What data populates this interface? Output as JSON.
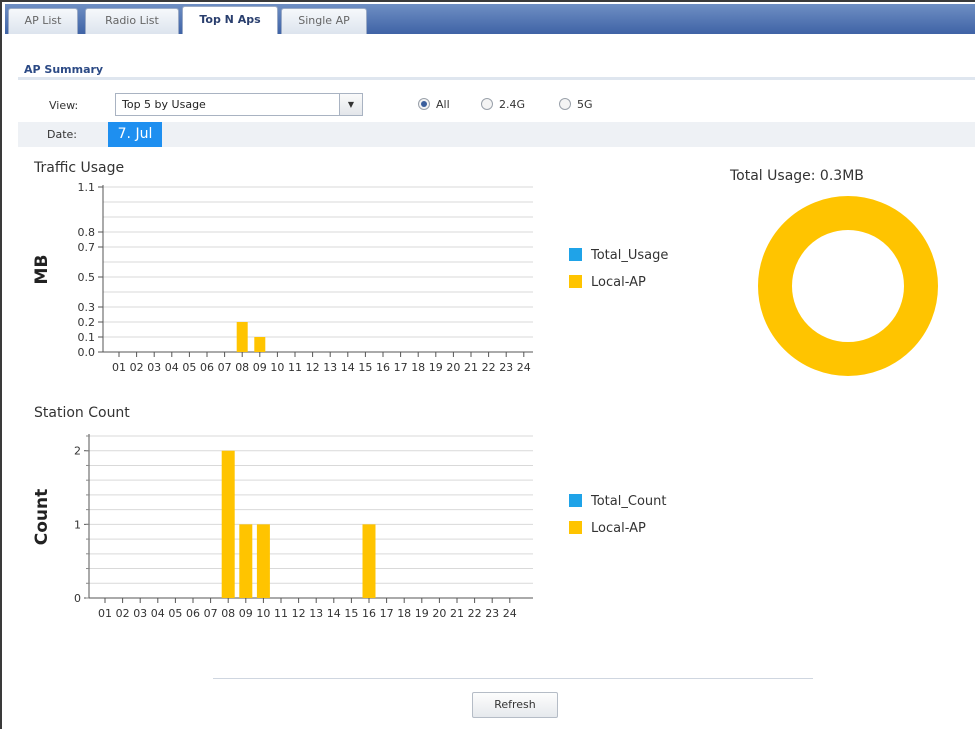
{
  "tabs": [
    {
      "label": "AP List",
      "active": false
    },
    {
      "label": "Radio List",
      "active": false
    },
    {
      "label": "Top N Aps",
      "active": true
    },
    {
      "label": "Single AP",
      "active": false
    }
  ],
  "section": {
    "title": "AP Summary"
  },
  "filters": {
    "view_label": "View:",
    "view_value": "Top 5 by Usage",
    "band_options": [
      {
        "label": "All",
        "selected": true
      },
      {
        "label": "2.4G",
        "selected": false
      },
      {
        "label": "5G",
        "selected": false
      }
    ],
    "date_label": "Date:",
    "date_value": "7. Jul"
  },
  "colors": {
    "total": "#1fa3e8",
    "local_ap": "#ffc400",
    "accent": "#1e8ff0"
  },
  "traffic": {
    "title": "Traffic Usage"
  },
  "station": {
    "title": "Station Count"
  },
  "donut": {
    "title": "Total Usage: 0.3MB"
  },
  "buttons": {
    "refresh": "Refresh"
  },
  "chart_data": [
    {
      "type": "bar",
      "title": "Traffic Usage",
      "ylabel": "MB",
      "categories": [
        "01",
        "02",
        "03",
        "04",
        "05",
        "06",
        "07",
        "08",
        "09",
        "10",
        "11",
        "12",
        "13",
        "14",
        "15",
        "16",
        "17",
        "18",
        "19",
        "20",
        "21",
        "22",
        "23",
        "24"
      ],
      "y_ticks": [
        0.0,
        0.1,
        0.2,
        0.3,
        0.5,
        0.7,
        0.8,
        1.1
      ],
      "ylim": [
        0,
        1.1
      ],
      "series": [
        {
          "name": "Total_Usage",
          "values": [
            0,
            0,
            0,
            0,
            0,
            0,
            0,
            0,
            0,
            0,
            0,
            0,
            0,
            0,
            0,
            0,
            0,
            0,
            0,
            0,
            0,
            0,
            0,
            0
          ]
        },
        {
          "name": "Local-AP",
          "values": [
            0,
            0,
            0,
            0,
            0,
            0,
            0,
            0.2,
            0.1,
            0,
            0,
            0,
            0,
            0,
            0,
            0,
            0,
            0,
            0,
            0,
            0,
            0,
            0,
            0
          ]
        }
      ],
      "legend": "right"
    },
    {
      "type": "bar",
      "title": "Station Count",
      "ylabel": "Count",
      "categories": [
        "01",
        "02",
        "03",
        "04",
        "05",
        "06",
        "07",
        "08",
        "09",
        "10",
        "11",
        "12",
        "13",
        "14",
        "15",
        "16",
        "17",
        "18",
        "19",
        "20",
        "21",
        "22",
        "23",
        "24"
      ],
      "y_ticks": [
        0,
        1,
        2
      ],
      "ylim": [
        0,
        2.2
      ],
      "series": [
        {
          "name": "Total_Count",
          "values": [
            0,
            0,
            0,
            0,
            0,
            0,
            0,
            0,
            0,
            0,
            0,
            0,
            0,
            0,
            0,
            0,
            0,
            0,
            0,
            0,
            0,
            0,
            0,
            0
          ]
        },
        {
          "name": "Local-AP",
          "values": [
            0,
            0,
            0,
            0,
            0,
            0,
            0,
            2,
            1,
            1,
            0,
            0,
            0,
            0,
            0,
            1,
            0,
            0,
            0,
            0,
            0,
            0,
            0,
            0
          ]
        }
      ],
      "legend": "right"
    },
    {
      "type": "pie",
      "title": "Total Usage: 0.3MB",
      "labels": [
        "Local-AP"
      ],
      "values": [
        0.3
      ],
      "donut": true
    }
  ]
}
